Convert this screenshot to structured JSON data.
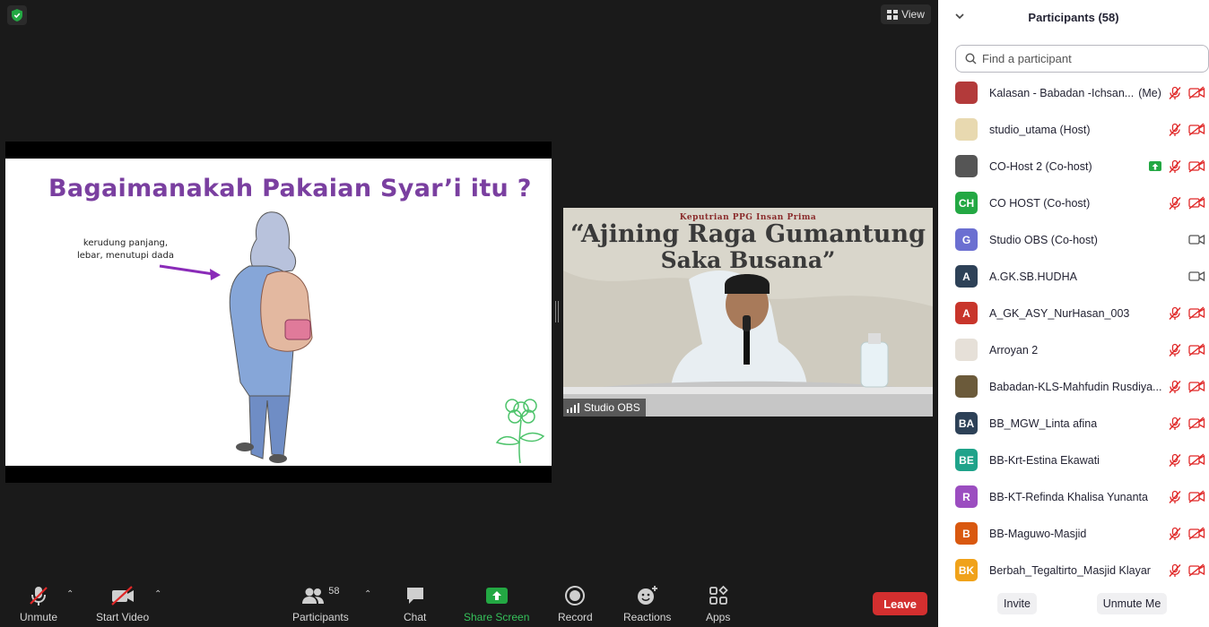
{
  "meeting": {
    "view_label": "View"
  },
  "slide": {
    "title": "Bagaimanakah Pakaian Syar’i itu ?",
    "note_line1": "kerudung panjang,",
    "note_line2": "lebar, menutupi dada"
  },
  "speaker": {
    "banner_top": "Keputrian PPG Insan Prima",
    "banner_line1": "“Ajining Raga Gumantung",
    "banner_line2": "Saka Busana”",
    "name": "Studio OBS"
  },
  "toolbar": {
    "unmute": "Unmute",
    "start_video": "Start Video",
    "participants": "Participants",
    "participants_count": "58",
    "chat": "Chat",
    "share_screen": "Share Screen",
    "record": "Record",
    "reactions": "Reactions",
    "apps": "Apps",
    "leave": "Leave"
  },
  "panel": {
    "title": "Participants (58)",
    "search_placeholder": "Find a participant",
    "invite": "Invite",
    "unmute_me": "Unmute Me",
    "participants": [
      {
        "name": "Kalasan - Babadan -Ichsan...",
        "suffix": "(Me)",
        "initials": "",
        "color": "#b33a3a",
        "video": "off"
      },
      {
        "name": "studio_utama (Host)",
        "suffix": "",
        "initials": "",
        "color": "#e8d9b0",
        "video": "off"
      },
      {
        "name": "CO-Host 2 (Co-host)",
        "suffix": "",
        "initials": "",
        "color": "#555555",
        "video": "off",
        "sharing": true
      },
      {
        "name": "CO HOST (Co-host)",
        "suffix": "",
        "initials": "CH",
        "color": "#23a843",
        "video": "off"
      },
      {
        "name": "Studio OBS (Co-host)",
        "suffix": "",
        "initials": "G",
        "color": "#6b6fd1",
        "video": "on"
      },
      {
        "name": "A.GK.SB.HUDHA",
        "suffix": "",
        "initials": "A",
        "color": "#2d4157",
        "video": "on"
      },
      {
        "name": "A_GK_ASY_NurHasan_003",
        "suffix": "",
        "initials": "A",
        "color": "#c8352b",
        "video": "off"
      },
      {
        "name": "Arroyan 2",
        "suffix": "",
        "initials": "",
        "color": "#e6e0d8",
        "video": "off"
      },
      {
        "name": "Babadan-KLS-Mahfudin Rusdiya...",
        "suffix": "",
        "initials": "",
        "color": "#6b5a3a",
        "video": "off"
      },
      {
        "name": "BB_MGW_Linta afina",
        "suffix": "",
        "initials": "BA",
        "color": "#2d4157",
        "video": "off"
      },
      {
        "name": "BB-Krt-Estina Ekawati",
        "suffix": "",
        "initials": "BE",
        "color": "#1fa38a",
        "video": "off"
      },
      {
        "name": "BB-KT-Refinda Khalisa Yunanta",
        "suffix": "",
        "initials": "R",
        "color": "#9b4dc0",
        "video": "off"
      },
      {
        "name": "BB-Maguwo-Masjid",
        "suffix": "",
        "initials": "B",
        "color": "#d9580f",
        "video": "off"
      },
      {
        "name": "Berbah_Tegaltirto_Masjid Klayar",
        "suffix": "",
        "initials": "BK",
        "color": "#f0a21a",
        "video": "off"
      }
    ]
  }
}
